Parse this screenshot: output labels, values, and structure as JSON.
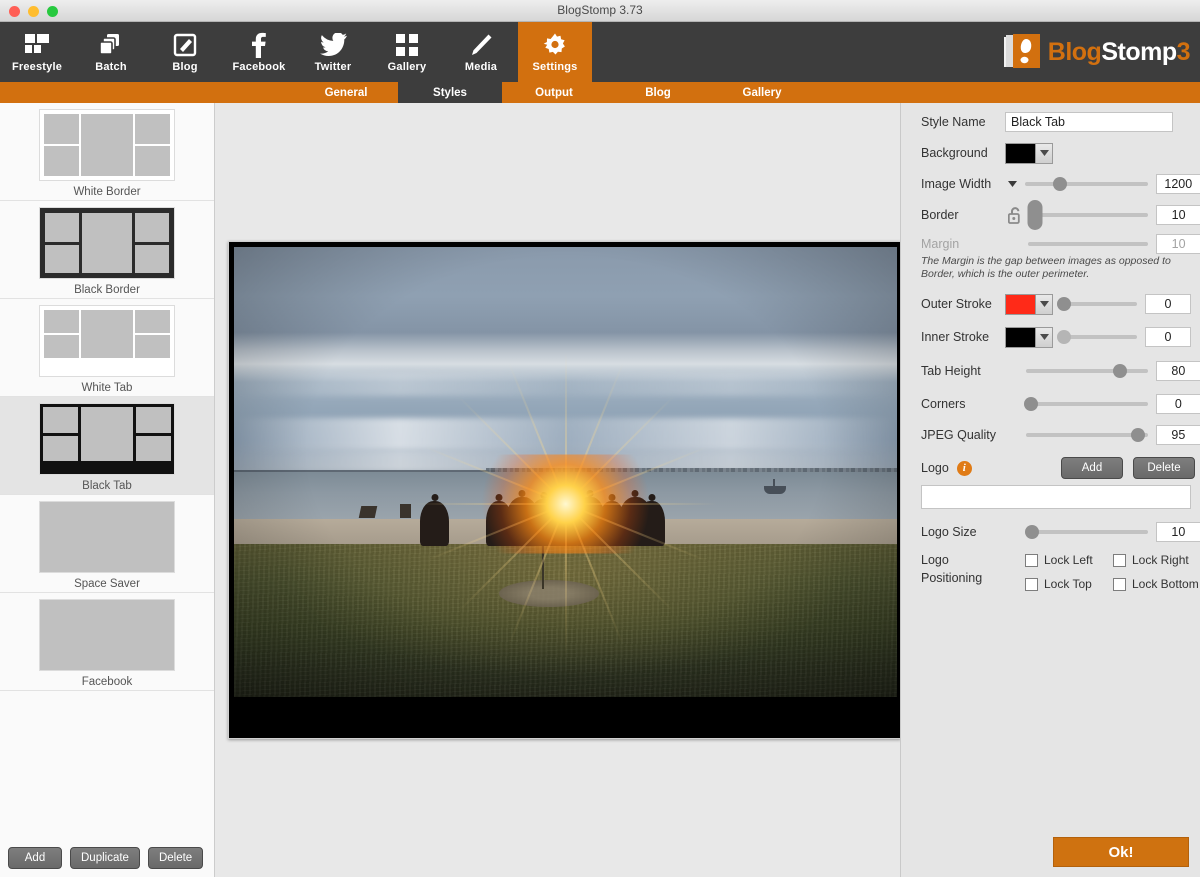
{
  "window": {
    "title": "BlogStomp 3.73",
    "traffic_lights": [
      "close",
      "minimize",
      "zoom"
    ]
  },
  "brand": {
    "logo_blog": "Blog",
    "logo_stomp": "Stomp",
    "logo_three": "3",
    "accent_color": "#d2700f",
    "toolbar_color": "#3d3d3d"
  },
  "toolbar": {
    "items": [
      {
        "label": "Freestyle",
        "icon": "grid-layout-icon",
        "active": false
      },
      {
        "label": "Batch",
        "icon": "stacked-pages-icon",
        "active": false
      },
      {
        "label": "Blog",
        "icon": "compose-square-icon",
        "active": false
      },
      {
        "label": "Facebook",
        "icon": "facebook-f-icon",
        "active": false
      },
      {
        "label": "Twitter",
        "icon": "twitter-bird-icon",
        "active": false
      },
      {
        "label": "Gallery",
        "icon": "four-squares-icon",
        "active": false
      },
      {
        "label": "Media",
        "icon": "pencil-icon",
        "active": false
      },
      {
        "label": "Settings",
        "icon": "gear-icon",
        "active": true
      }
    ]
  },
  "subnav": {
    "items": [
      {
        "label": "General",
        "active": false
      },
      {
        "label": "Styles",
        "active": true
      },
      {
        "label": "Output",
        "active": false
      },
      {
        "label": "Blog",
        "active": false
      },
      {
        "label": "Gallery",
        "active": false
      }
    ]
  },
  "sidebar": {
    "styles": [
      {
        "label": "White Border",
        "selected": false,
        "kind": "white-border"
      },
      {
        "label": "Black Border",
        "selected": false,
        "kind": "black-border"
      },
      {
        "label": "White Tab",
        "selected": false,
        "kind": "white-tab"
      },
      {
        "label": "Black Tab",
        "selected": true,
        "kind": "black-tab"
      },
      {
        "label": "Space Saver",
        "selected": false,
        "kind": "plain"
      },
      {
        "label": "Facebook",
        "selected": false,
        "kind": "plain"
      }
    ],
    "buttons": {
      "add": "Add",
      "duplicate": "Duplicate",
      "delete": "Delete"
    }
  },
  "preview": {
    "alt": "Sunset beach photo with group of people silhouetted against the sun, city skyline, water and grass field",
    "frame_style": "black-tab"
  },
  "settings": {
    "style_name_label": "Style Name",
    "style_name_value": "Black Tab",
    "background_label": "Background",
    "background_color": "#000000",
    "image_width_label": "Image Width",
    "image_width_value": "1200",
    "image_width_slider_pct": 28,
    "border_label": "Border",
    "border_value": "10",
    "border_slider_pct": 6,
    "margin_label": "Margin",
    "margin_value": "10",
    "margin_disabled": true,
    "lock_icon": "open-padlock-icon",
    "help_text": "The Margin is the gap between images as opposed to Border, which is the outer perimeter.",
    "outer_stroke_label": "Outer Stroke",
    "outer_stroke_color": "#ff2a18",
    "outer_stroke_value": "0",
    "outer_stroke_slider_pct": 4,
    "inner_stroke_label": "Inner Stroke",
    "inner_stroke_color": "#000000",
    "inner_stroke_value": "0",
    "inner_stroke_slider_pct": 4,
    "tab_height_label": "Tab Height",
    "tab_height_value": "80",
    "tab_height_slider_pct": 77,
    "corners_label": "Corners",
    "corners_value": "0",
    "corners_slider_pct": 4,
    "jpeg_quality_label": "JPEG Quality",
    "jpeg_quality_value": "95",
    "jpeg_quality_slider_pct": 92,
    "logo_label": "Logo",
    "logo_info_icon": "info-icon",
    "logo_add": "Add",
    "logo_delete": "Delete",
    "logo_path_value": "",
    "logo_size_label": "Logo Size",
    "logo_size_value": "10",
    "logo_size_slider_pct": 5,
    "logo_positioning_label_line1": "Logo",
    "logo_positioning_label_line2": "Positioning",
    "lock_left": "Lock Left",
    "lock_right": "Lock Right",
    "lock_top": "Lock Top",
    "lock_bottom": "Lock Bottom",
    "ok_button": "Ok!"
  }
}
